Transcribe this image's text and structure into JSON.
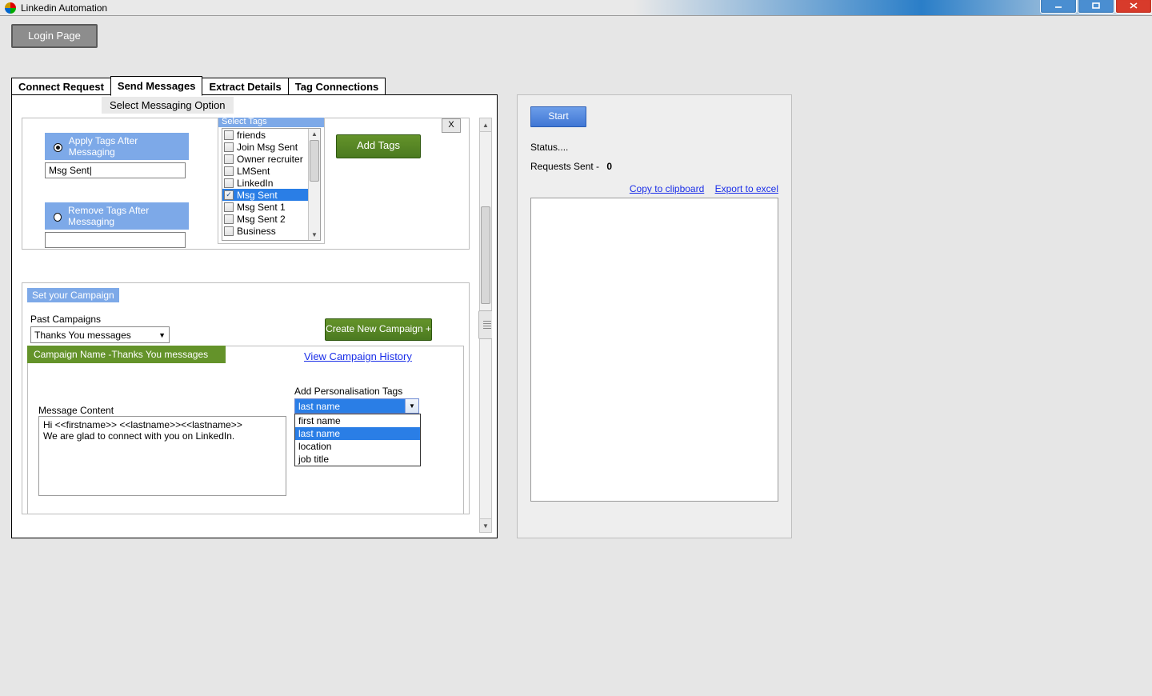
{
  "window": {
    "title": "Linkedin Automation"
  },
  "login_button": "Login Page",
  "tabs": [
    "Connect Request",
    "Send Messages",
    "Extract Details",
    "Tag Connections"
  ],
  "active_tab_index": 1,
  "subheader": "Select Messaging Option",
  "tag_options": {
    "apply": {
      "label": "Apply Tags After Messaging",
      "value": "Msg Sent|"
    },
    "remove": {
      "label": "Remove Tags After Messaging",
      "value": ""
    },
    "select_tags_header": "Select Tags",
    "tags": [
      {
        "label": "friends",
        "checked": false
      },
      {
        "label": "Join Msg Sent",
        "checked": false
      },
      {
        "label": "Owner recruiter",
        "checked": false
      },
      {
        "label": "LMSent",
        "checked": false
      },
      {
        "label": "LinkedIn",
        "checked": false
      },
      {
        "label": "Msg Sent",
        "checked": true,
        "selected": true
      },
      {
        "label": "Msg Sent 1",
        "checked": false
      },
      {
        "label": "Msg Sent 2",
        "checked": false
      },
      {
        "label": "Business",
        "checked": false
      }
    ],
    "add_tags_btn": "Add Tags",
    "close_btn": "X"
  },
  "campaign": {
    "set_label": "Set your Campaign",
    "past_label": "Past Campaigns",
    "past_selected": "Thanks You messages",
    "create_btn": "Create New Campaign +",
    "name_label": "Campaign Name -Thanks You messages",
    "view_history": "View Campaign History",
    "persona_label": "Add Personalisation Tags",
    "persona_selected": "last name",
    "persona_options": [
      "first name",
      "last name",
      "location",
      "job title"
    ],
    "msg_label": "Message Content",
    "msg_value": "Hi <<firstname>> <<lastname>><<lastname>>\nWe are glad to connect with you on LinkedIn."
  },
  "right": {
    "start_btn": "Start",
    "status": "Status....",
    "requests_label": "Requests Sent -",
    "requests_value": "0",
    "copy_link": "Copy to clipboard",
    "export_link": "Export to excel"
  }
}
